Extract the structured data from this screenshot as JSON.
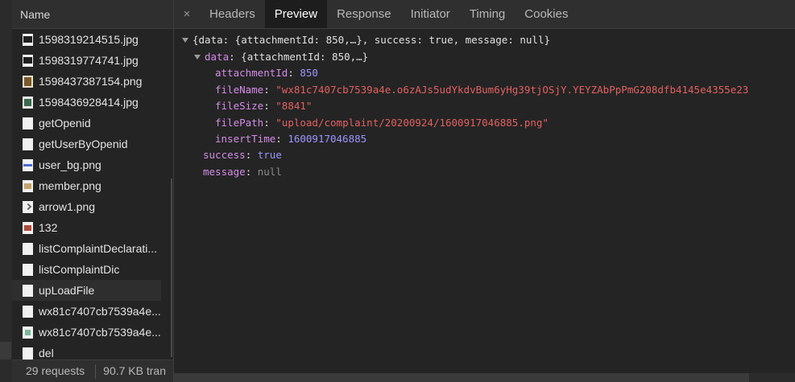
{
  "name_panel": {
    "header": "Name",
    "files": [
      {
        "name": "1598319214515.jpg",
        "icon": "image-dark-icon"
      },
      {
        "name": "1598319774741.jpg",
        "icon": "image-dark-icon"
      },
      {
        "name": "1598437387154.png",
        "icon": "image-brown-icon"
      },
      {
        "name": "1598436928414.jpg",
        "icon": "image-green-icon"
      },
      {
        "name": "getOpenid",
        "icon": "document-icon"
      },
      {
        "name": "getUserByOpenid",
        "icon": "document-icon"
      },
      {
        "name": "user_bg.png",
        "icon": "image-blue-icon"
      },
      {
        "name": "member.png",
        "icon": "image-orange-icon"
      },
      {
        "name": "arrow1.png",
        "icon": "arrow-image-icon"
      },
      {
        "name": "132",
        "icon": "image-red-icon"
      },
      {
        "name": "listComplaintDeclarati...",
        "icon": "document-icon"
      },
      {
        "name": "listComplaintDic",
        "icon": "document-icon"
      },
      {
        "name": "upLoadFile",
        "icon": "document-icon"
      },
      {
        "name": "wx81c7407cb7539a4e...",
        "icon": "document-icon"
      },
      {
        "name": "wx81c7407cb7539a4e...",
        "icon": "image-mint-icon"
      },
      {
        "name": "del",
        "icon": "document-icon"
      }
    ],
    "selected_index": 12
  },
  "status_bar": {
    "requests": "29 requests",
    "transferred": "90.7 KB tran"
  },
  "tabs": {
    "close": "×",
    "items": [
      {
        "label": "Headers"
      },
      {
        "label": "Preview"
      },
      {
        "label": "Response"
      },
      {
        "label": "Initiator"
      },
      {
        "label": "Timing"
      },
      {
        "label": "Cookies"
      }
    ],
    "active_index": 1
  },
  "preview": {
    "root_summary": "{data: {attachmentId: 850,…}, success: true, message: null}",
    "data_key": "data",
    "data_summary": "{attachmentId: 850,…}",
    "attachmentId_key": "attachmentId",
    "attachmentId_value": "850",
    "fileName_key": "fileName",
    "fileName_value": "\"wx81c7407cb7539a4e.o6zAJs5udYkdvBum6yHg39tjOSjY.YEYZAbPpPmG208dfb4145e4355e23",
    "fileSize_key": "fileSize",
    "fileSize_value": "\"8841\"",
    "filePath_key": "filePath",
    "filePath_value": "\"upload/complaint/20200924/1600917046885.png\"",
    "insertTime_key": "insertTime",
    "insertTime_value": "1600917046885",
    "success_key": "success",
    "success_value": "true",
    "message_key": "message",
    "message_value": "null",
    "colon": ":"
  }
}
